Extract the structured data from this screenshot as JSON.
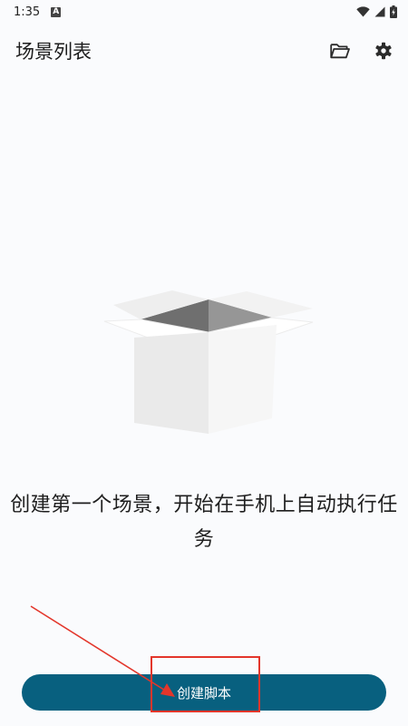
{
  "status_bar": {
    "time": "1:35",
    "notification_icon": "a-letter-icon",
    "icons": [
      "wifi-icon",
      "signal-icon",
      "battery-icon"
    ]
  },
  "app_bar": {
    "title": "场景列表",
    "actions": [
      "folder-icon",
      "gear-icon"
    ]
  },
  "empty_state": {
    "illustration": "open-box-icon",
    "message": "创建第一个场景，开始在手机上自动执行任务"
  },
  "create_button": {
    "label": "创建脚本",
    "color": "#08607f"
  },
  "annotation": {
    "color": "#e3362b"
  }
}
